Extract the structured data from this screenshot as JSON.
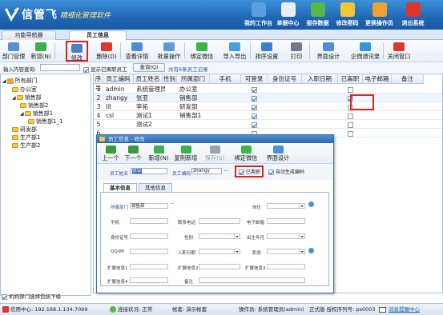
{
  "app": {
    "title": "信管飞",
    "subtitle": "精细化管理软件",
    "brand_color": "#1f67b4"
  },
  "top_buttons": [
    {
      "label": "我的工作台",
      "icon": "monitor-icon",
      "color": "#5aa0e0"
    },
    {
      "label": "单据中心",
      "icon": "documents-icon",
      "color": "#e8eef8"
    },
    {
      "label": "报存数据",
      "icon": "save-data-icon",
      "color": "#57b847"
    },
    {
      "label": "修改密码",
      "icon": "lock-icon",
      "color": "#f3c531"
    },
    {
      "label": "更换操作员",
      "icon": "user-icon",
      "color": "#f0a030"
    },
    {
      "label": "退出系统",
      "icon": "exit-icon",
      "color": "#e0332b"
    }
  ],
  "tabs": [
    {
      "label": "功能导航器",
      "active": false
    },
    {
      "label": "员工信息",
      "active": true
    }
  ],
  "toolbar": [
    {
      "label": "部门管理",
      "icon": "department-icon"
    },
    {
      "label": "新增(N)",
      "icon": "add-icon"
    },
    {
      "label": "修改(M)",
      "icon": "edit-icon",
      "highlight": true
    },
    {
      "label": "删除(D)",
      "icon": "delete-icon"
    },
    {
      "label": "查看详情",
      "icon": "details-icon"
    },
    {
      "label": "批量操作",
      "icon": "batch-icon"
    },
    {
      "label": "绑定微信",
      "icon": "wechat-icon"
    },
    {
      "label": "导入导出",
      "icon": "import-export-icon"
    },
    {
      "label": "排序设置",
      "icon": "sort-icon"
    },
    {
      "label": "打印",
      "icon": "print-icon"
    },
    {
      "label": "界面设计",
      "icon": "design-icon"
    },
    {
      "label": "企微通讯录",
      "icon": "contacts-icon"
    },
    {
      "label": "关闭窗口",
      "icon": "close-window-icon"
    }
  ],
  "search": {
    "label": "输入内容查询:",
    "value": "",
    "show_deactivated_label": "显示已离职员工",
    "query_button": "查询(Q)",
    "record_count": "共有6条员工记录"
  },
  "tree": {
    "items": [
      {
        "label": "所有部门",
        "level": 0
      },
      {
        "label": "办公室",
        "level": 1
      },
      {
        "label": "销售部",
        "level": 1
      },
      {
        "label": "销售部2",
        "level": 2
      },
      {
        "label": "销售部1",
        "level": 2
      },
      {
        "label": "销售部1_1",
        "level": 3
      },
      {
        "label": "研发部",
        "level": 1
      },
      {
        "label": "生产部1",
        "level": 1
      },
      {
        "label": "生产部2",
        "level": 1
      }
    ],
    "footer_checkbox": "机构部门选择包括下级"
  },
  "grid": {
    "columns": [
      "序号",
      "员工编码",
      "员工姓名",
      "性别",
      "所属部门",
      "手机",
      "可登录",
      "身份证号",
      "入职日期",
      "已离职",
      "电子邮箱",
      "备注"
    ],
    "rows": [
      {
        "no": "1",
        "code": "admin",
        "name": "系统管理员",
        "gender": "",
        "dept": "办公室",
        "login": true,
        "resigned": false
      },
      {
        "no": "2",
        "code": "zhangy",
        "name": "张亚",
        "gender": "",
        "dept": "销售部",
        "login": true,
        "resigned": true
      },
      {
        "no": "3",
        "code": "lit",
        "name": "李拓",
        "gender": "",
        "dept": "研发部",
        "login": true,
        "resigned": false
      },
      {
        "no": "4",
        "code": "csl",
        "name": "测试1",
        "gender": "",
        "dept": "销售部1",
        "login": true,
        "resigned": false
      },
      {
        "no": "5",
        "code": "",
        "name": "测试2",
        "gender": "",
        "dept": "",
        "login": true,
        "resigned": false
      },
      {
        "no": "6",
        "code": "",
        "name": "",
        "gender": "",
        "dept": "",
        "login": false,
        "resigned": false
      }
    ]
  },
  "dialog": {
    "title": "员工信息 - 修改",
    "toolbar": [
      {
        "label": "上一个",
        "icon": "prev-icon",
        "disabled": false
      },
      {
        "label": "下一个",
        "icon": "next-icon",
        "disabled": false
      },
      {
        "label": "新增(N)",
        "icon": "add-icon",
        "disabled": false
      },
      {
        "label": "复制新增",
        "icon": "copy-add-icon",
        "disabled": false
      },
      {
        "label": "保存(S)",
        "icon": "save-icon",
        "disabled": true
      },
      {
        "label": "绑定微信",
        "icon": "wechat-icon",
        "disabled": false
      },
      {
        "label": "界面设计",
        "icon": "design-icon",
        "disabled": false
      }
    ],
    "name_label": "员工姓名",
    "name_value": "张亚",
    "code_label": "员工编码",
    "code_value": "zhangy",
    "resigned_label": "已离职",
    "auto_code_label": "自动生成编码",
    "tabs": [
      "基本信息",
      "其他信息"
    ],
    "form": {
      "dept_label": "所属部门",
      "dept_value": "销售部",
      "position_label": "岗位",
      "phone_label": "手机",
      "contact_label": "联系电话",
      "email_label": "电子邮箱",
      "idcard_label": "身份证号",
      "gender_label": "性别",
      "birthday_label": "出生年月",
      "qq_label": "QQ/IM",
      "hire_date_label": "入职日期",
      "duty_label": "职务",
      "ext1_label": "扩展信息1",
      "ext2_label": "扩展信息2",
      "ext3_label": "扩展信息3",
      "ext4_label": "扩展信息4",
      "remark_label": "备注"
    }
  },
  "status": {
    "app_center": "信用中心: 192.168.1.134:7099",
    "connection": "连接状况: 正常",
    "account": "帐套: 演示帐套",
    "operator": "操作员: 系统管理员(admin)",
    "license": "正式版 授权序列号: ps0003",
    "message": "消息提醒中心"
  }
}
